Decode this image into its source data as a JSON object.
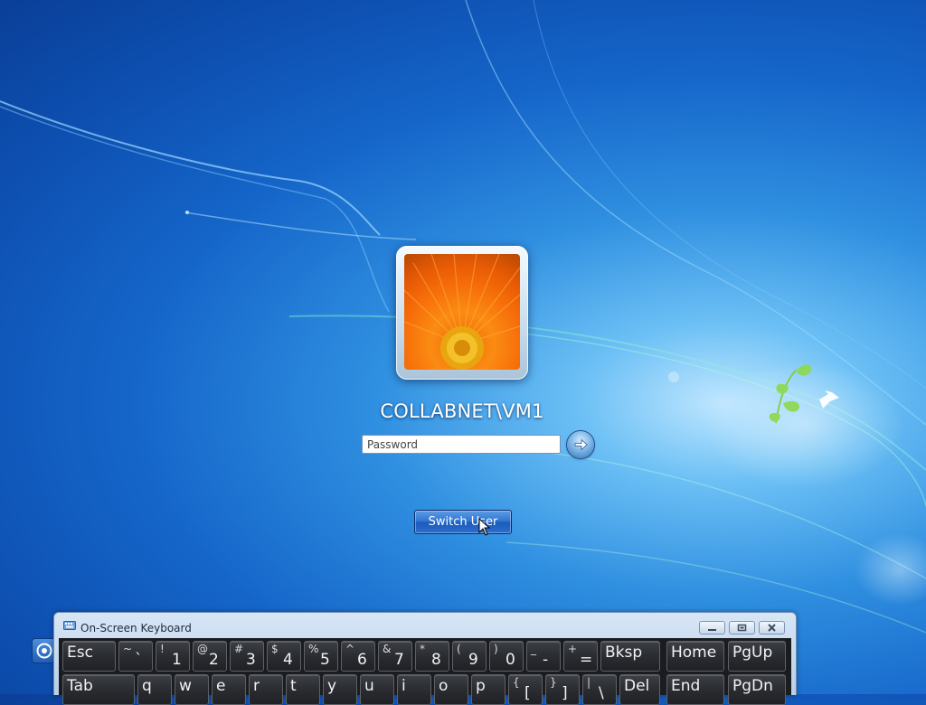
{
  "colors": {
    "background": "#1565c9",
    "button": "#2e73cf",
    "keyboard": "#2a2c31"
  },
  "user": {
    "name": "COLLABNET\\VM1",
    "avatar_icon": "flower-picture"
  },
  "password": {
    "placeholder": "Password",
    "value": ""
  },
  "submit_icon": "arrow-right-icon",
  "switch_user_label": "Switch User",
  "ease_icon": "ease-of-access-icon",
  "osk": {
    "title": "On-Screen Keyboard",
    "row1": [
      {
        "label": "Esc"
      },
      {
        "shift": "~",
        "primary": "`"
      },
      {
        "shift": "!",
        "primary": "1"
      },
      {
        "shift": "@",
        "primary": "2"
      },
      {
        "shift": "#",
        "primary": "3"
      },
      {
        "shift": "$",
        "primary": "4"
      },
      {
        "shift": "%",
        "primary": "5"
      },
      {
        "shift": "^",
        "primary": "6"
      },
      {
        "shift": "&",
        "primary": "7"
      },
      {
        "shift": "*",
        "primary": "8"
      },
      {
        "shift": "(",
        "primary": "9"
      },
      {
        "shift": ")",
        "primary": "0"
      },
      {
        "shift": "_",
        "primary": "-"
      },
      {
        "shift": "+",
        "primary": "="
      },
      {
        "label": "Bksp"
      },
      {
        "label": "Home"
      },
      {
        "label": "PgUp"
      }
    ],
    "row2": [
      {
        "label": "Tab"
      },
      {
        "label": "q"
      },
      {
        "label": "w"
      },
      {
        "label": "e"
      },
      {
        "label": "r"
      },
      {
        "label": "t"
      },
      {
        "label": "y"
      },
      {
        "label": "u"
      },
      {
        "label": "i"
      },
      {
        "label": "o"
      },
      {
        "label": "p"
      },
      {
        "shift": "{",
        "primary": "["
      },
      {
        "shift": "}",
        "primary": "]"
      },
      {
        "shift": "|",
        "primary": "\\"
      },
      {
        "label": "Del"
      },
      {
        "label": "End"
      },
      {
        "label": "PgDn"
      }
    ]
  }
}
